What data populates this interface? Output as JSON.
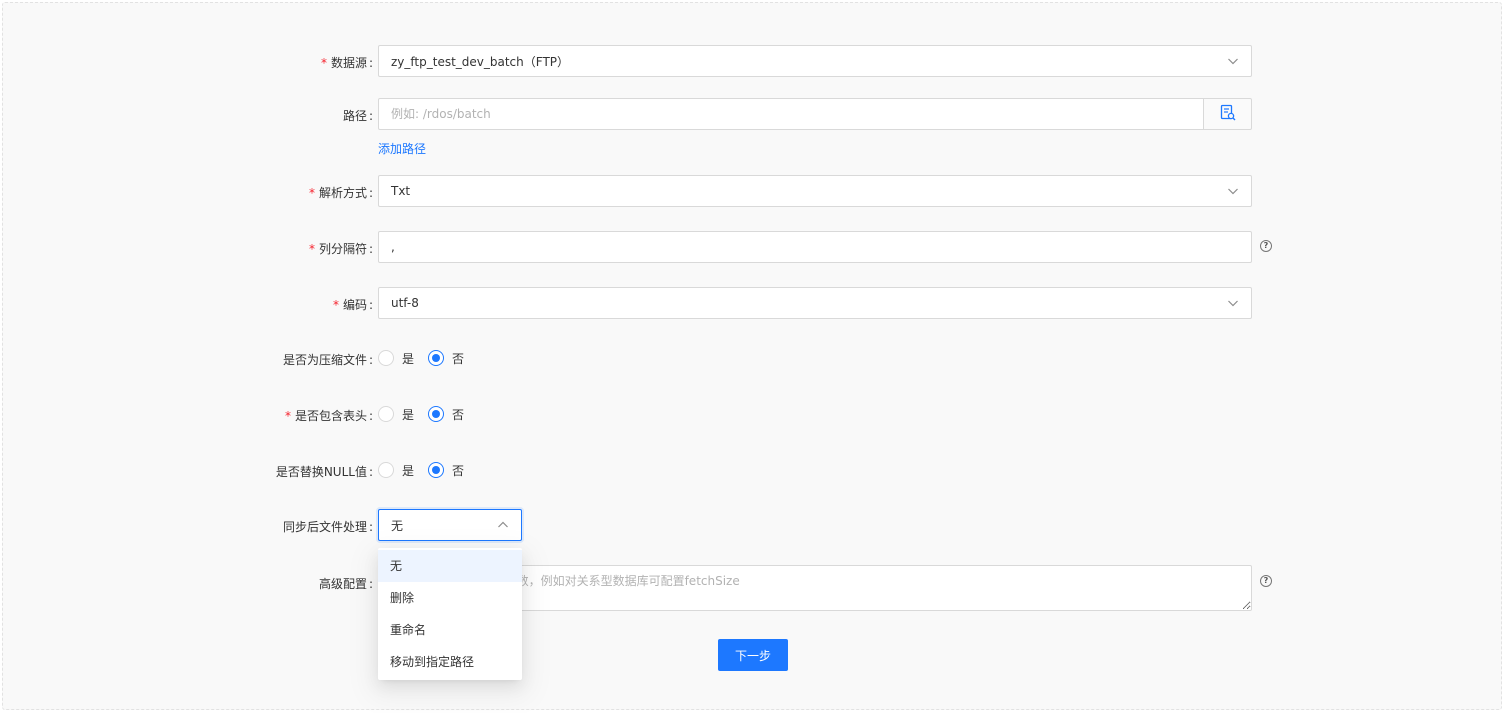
{
  "form": {
    "datasource": {
      "label": "数据源",
      "required": true,
      "value": "zy_ftp_test_dev_batch（FTP）"
    },
    "path": {
      "label": "路径",
      "placeholder": "例如: /rdos/batch",
      "add_link": "添加路径"
    },
    "parse_method": {
      "label": "解析方式",
      "required": true,
      "value": "Txt"
    },
    "column_delimiter": {
      "label": "列分隔符",
      "required": true,
      "value": ","
    },
    "encoding": {
      "label": "编码",
      "required": true,
      "value": "utf-8"
    },
    "compressed": {
      "label": "是否为压缩文件",
      "options": [
        "是",
        "否"
      ],
      "selected": "否"
    },
    "has_header": {
      "label": "是否包含表头",
      "required": true,
      "options": [
        "是",
        "否"
      ],
      "selected": "否"
    },
    "replace_null": {
      "label": "是否替换NULL值",
      "options": [
        "是",
        "否"
      ],
      "selected": "否"
    },
    "post_sync": {
      "label": "同步后文件处理",
      "value": "无",
      "options": [
        "无",
        "删除",
        "重命名",
        "移动到指定路径"
      ]
    },
    "advanced": {
      "label": "高级配置",
      "placeholder": "以JSON格式添加高级参数，例如对关系型数据库可配置fetchSize"
    },
    "help_icon": "?",
    "required_mark": "*",
    "colon": ":"
  },
  "actions": {
    "next_label": "下一步"
  },
  "colors": {
    "primary": "#1d78ff",
    "required": "#f5222d",
    "border": "#d9d9d9",
    "background": "#f9f9f9"
  },
  "icons": {
    "select_arrow": "chevron-down-icon",
    "open_arrow": "chevron-up-icon",
    "path_button": "file-search-icon",
    "help": "question-circle-icon"
  }
}
